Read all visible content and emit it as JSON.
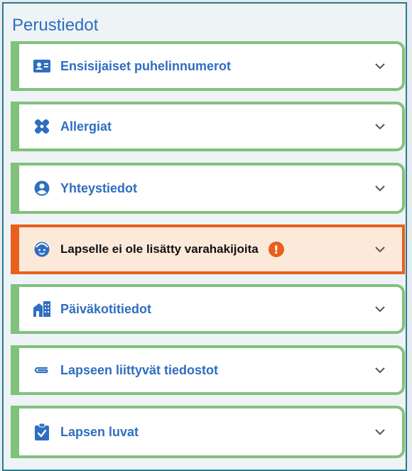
{
  "section": {
    "title": "Perustiedot"
  },
  "colors": {
    "accent_blue": "#2f6ec0",
    "ok_border": "#82c17b",
    "warn_border": "#e8601c",
    "warn_background": "#fde9d9"
  },
  "items": [
    {
      "label": "Ensisijaiset puhelinnumerot",
      "icon": "contact-card-icon",
      "state": "ok"
    },
    {
      "label": "Allergiat",
      "icon": "bandage-icon",
      "state": "ok"
    },
    {
      "label": "Yhteystiedot",
      "icon": "person-circle-icon",
      "state": "ok"
    },
    {
      "label": "Lapselle ei ole lisätty varahakijoita",
      "icon": "child-face-icon",
      "state": "warning",
      "alert_icon": "exclamation-icon"
    },
    {
      "label": "Päiväkotitiedot",
      "icon": "building-icon",
      "state": "ok"
    },
    {
      "label": "Lapseen liittyvät tiedostot",
      "icon": "paperclip-icon",
      "state": "ok"
    },
    {
      "label": "Lapsen luvat",
      "icon": "clipboard-check-icon",
      "state": "ok"
    }
  ],
  "expand_icon": "chevron-down-icon"
}
